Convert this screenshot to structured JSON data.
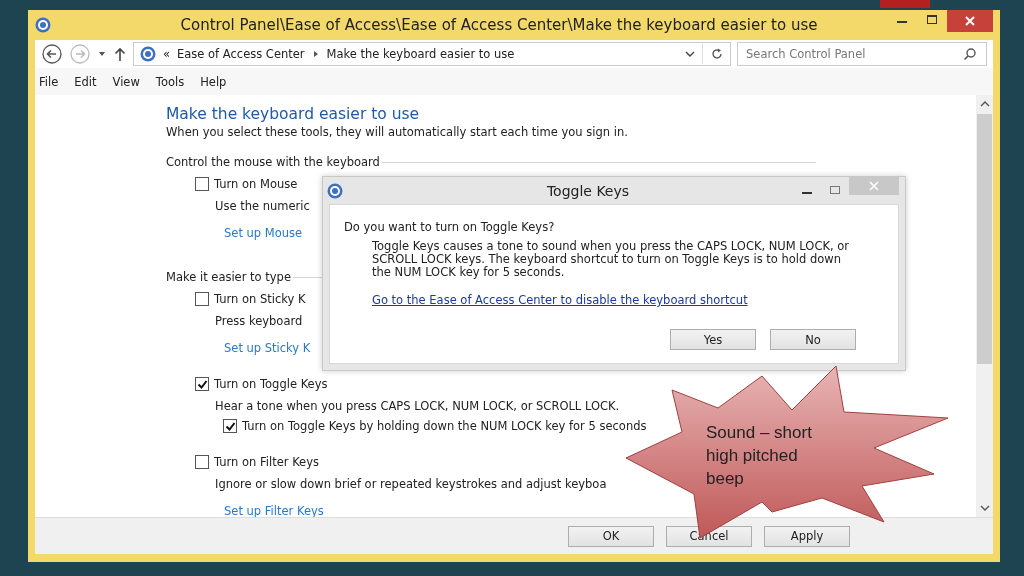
{
  "window": {
    "title": "Control Panel\\Ease of Access\\Ease of Access Center\\Make the keyboard easier to use"
  },
  "address_bar": {
    "overflow": "«",
    "crumbs": [
      "Ease of Access Center",
      "Make the keyboard easier to use"
    ]
  },
  "search": {
    "placeholder": "Search Control Panel"
  },
  "menu": [
    "File",
    "Edit",
    "View",
    "Tools",
    "Help"
  ],
  "page": {
    "title": "Make the keyboard easier to use",
    "subtitle": "When you select these tools, they will automatically start each time you sign in.",
    "sections": [
      {
        "heading": "Control the mouse with the keyboard",
        "items": [
          {
            "kind": "checkbox",
            "label": "Turn on Mouse",
            "checked": false,
            "children": [
              {
                "kind": "text",
                "text": "Use the numeric"
              },
              {
                "kind": "link",
                "text": "Set up Mouse"
              }
            ]
          }
        ]
      },
      {
        "heading": "Make it easier to type",
        "items": [
          {
            "kind": "checkbox",
            "label": "Turn on Sticky K",
            "checked": false,
            "children": [
              {
                "kind": "text",
                "text": "Press keyboard"
              },
              {
                "kind": "link",
                "text": "Set up Sticky K"
              }
            ]
          },
          {
            "kind": "checkbox",
            "label": "Turn on Toggle Keys",
            "checked": true,
            "children": [
              {
                "kind": "text",
                "text": "Hear a tone when you press CAPS LOCK, NUM LOCK, or SCROLL LOCK."
              },
              {
                "kind": "checkbox",
                "label": "Turn on Toggle Keys by holding down the NUM LOCK key for 5 seconds",
                "checked": true
              }
            ]
          },
          {
            "kind": "checkbox",
            "label": "Turn on Filter Keys",
            "checked": false,
            "children": [
              {
                "kind": "text",
                "text": "Ignore or slow down brief or repeated keystrokes and adjust keyboa"
              },
              {
                "kind": "link",
                "text": "Set up Filter Keys"
              }
            ]
          }
        ]
      }
    ]
  },
  "buttons": [
    "OK",
    "Cancel",
    "Apply"
  ],
  "dialog": {
    "title": "Toggle Keys",
    "question": "Do you want to turn on Toggle Keys?",
    "body": "Toggle Keys causes a tone to sound when you press the CAPS LOCK, NUM LOCK, or SCROLL LOCK keys.  The keyboard shortcut to turn on Toggle Keys is to hold down the NUM LOCK key for 5 seconds.",
    "link": "Go to the Ease of Access Center to disable the keyboard shortcut",
    "buttons": [
      "Yes",
      "No"
    ]
  },
  "callout": {
    "text": "Sound – short high pitched beep"
  }
}
